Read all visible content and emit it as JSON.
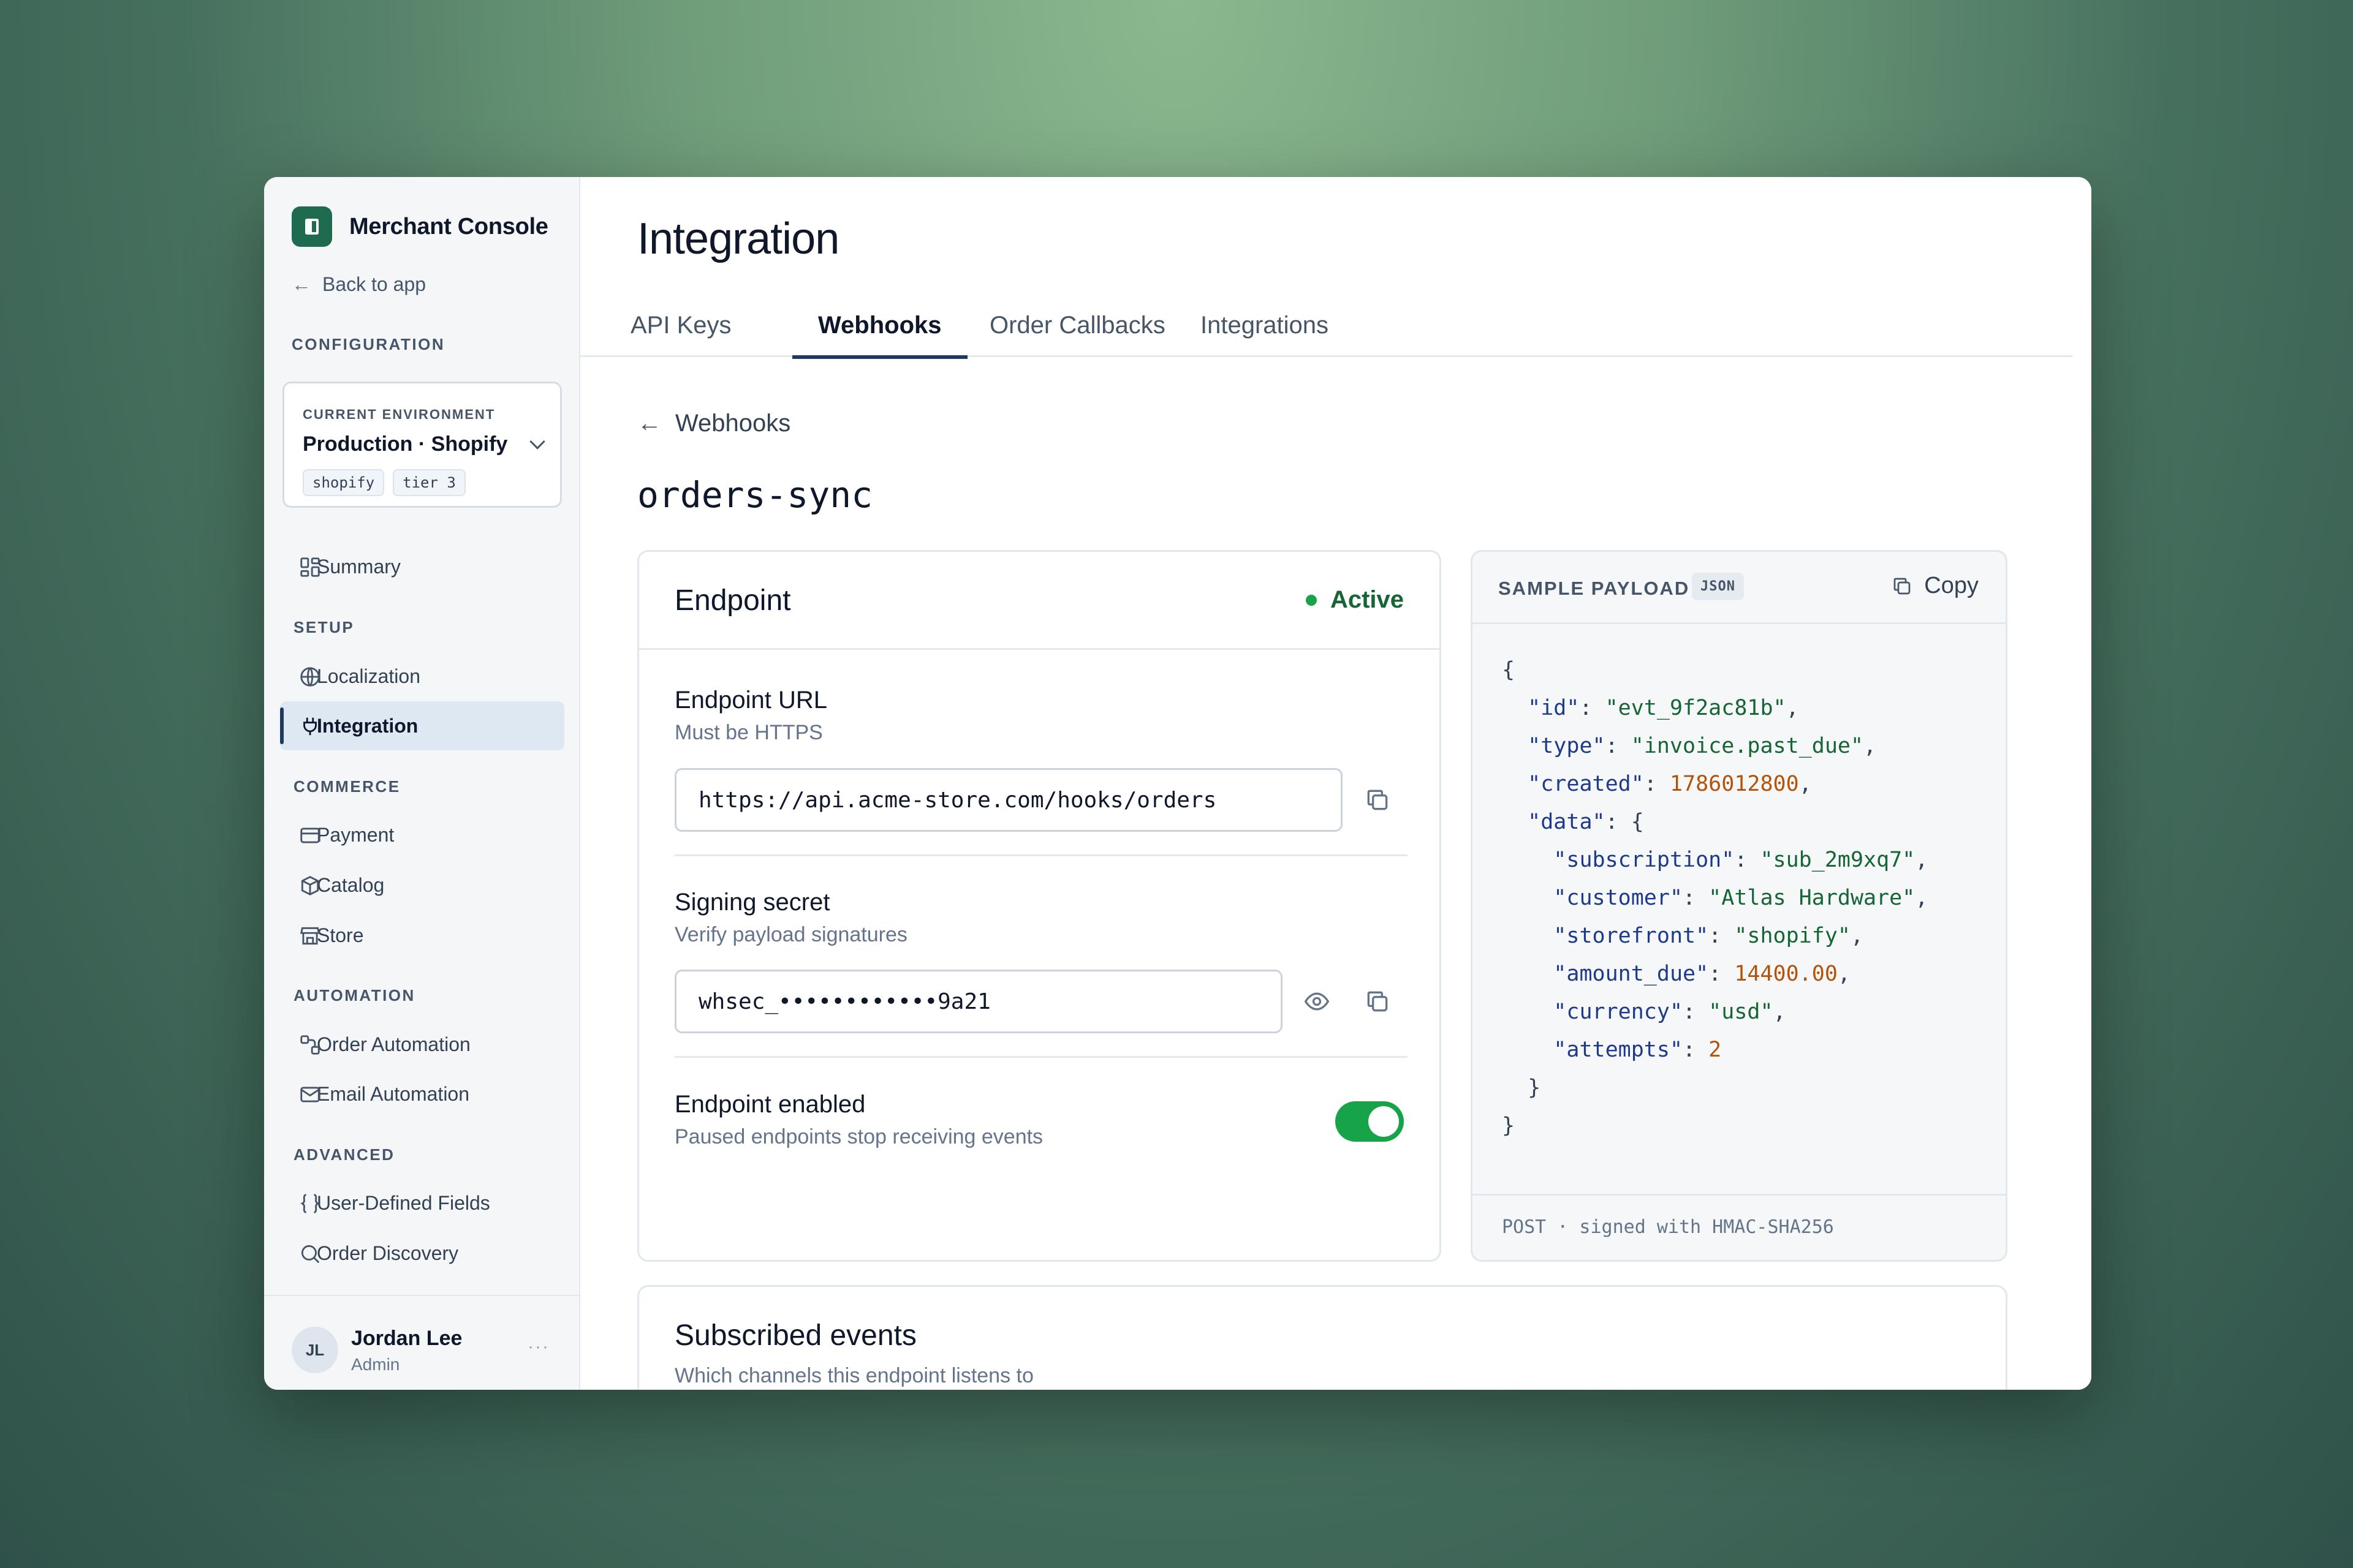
{
  "sidebar": {
    "brand": "Merchant Console",
    "back_label": "Back to app",
    "config_label": "CONFIGURATION",
    "env": {
      "label": "CURRENT ENVIRONMENT",
      "value": "Production · Shopify",
      "tags": [
        "shopify",
        "tier 3"
      ]
    },
    "summary": "Summary",
    "setup_label": "SETUP",
    "setup_items": [
      "Localization",
      "Integration"
    ],
    "commerce_label": "COMMERCE",
    "commerce_items": [
      "Payment",
      "Catalog",
      "Store"
    ],
    "automation_label": "AUTOMATION",
    "automation_items": [
      "Order Automation",
      "Email Automation"
    ],
    "advanced_label": "ADVANCED",
    "advanced_items": [
      "User-Defined Fields",
      "Order Discovery"
    ],
    "user": {
      "initials": "JL",
      "name": "Jordan Lee",
      "role": "Admin",
      "more": "···"
    }
  },
  "main": {
    "title": "Integration",
    "tabs": [
      "API Keys",
      "Webhooks",
      "Order Callbacks",
      "Integrations"
    ],
    "active_tab": "Webhooks",
    "breadcrumb": "Webhooks",
    "webhook_name": "orders-sync",
    "endpoint": {
      "title": "Endpoint",
      "status": "Active",
      "url_title": "Endpoint URL",
      "url_sub": "Must be HTTPS",
      "url_value": "https://api.acme-store.com/hooks/orders",
      "secret_title": "Signing secret",
      "secret_sub": "Verify payload signatures",
      "secret_value": "whsec_••••••••••••9a21",
      "enabled_title": "Endpoint enabled",
      "enabled_sub": "Paused endpoints stop receiving events",
      "enabled": true
    },
    "payload": {
      "title": "SAMPLE PAYLOAD",
      "format": "JSON",
      "copy": "Copy",
      "footer": "POST · signed with HMAC-SHA256",
      "lines": [
        "{",
        "  \"id\": \"evt_9f2ac81b\",",
        "  \"type\": \"invoice.past_due\",",
        "  \"created\": 1786012800,",
        "  \"data\": {",
        "    \"subscription\": \"sub_2m9xq7\",",
        "    \"customer\": \"Atlas Hardware\",",
        "    \"storefront\": \"shopify\",",
        "    \"amount_due\": 14400.00,",
        "    \"currency\": \"usd\",",
        "    \"attempts\": 2",
        "  }",
        "}"
      ]
    },
    "events": {
      "title": "Subscribed events",
      "sub": "Which channels this endpoint listens to"
    }
  },
  "colors": {
    "accent": "#1e3a5f",
    "brand": "#1f6b4f",
    "active": "#16a34a"
  }
}
